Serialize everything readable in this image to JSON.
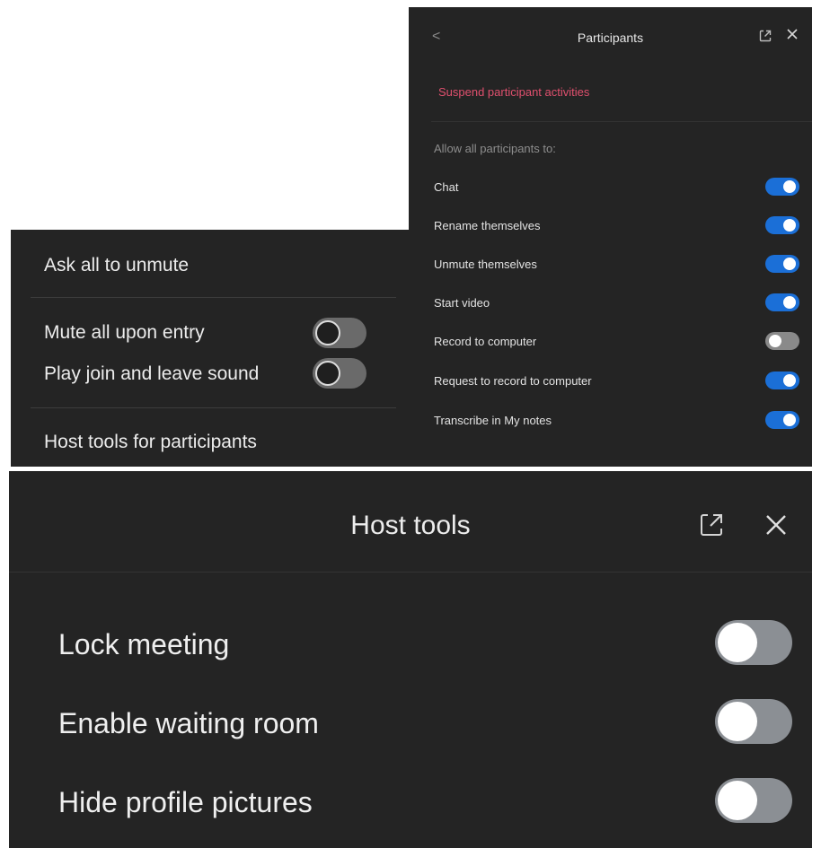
{
  "participants_panel": {
    "back_glyph": "<",
    "title": "Participants",
    "popout_icon": "popout-icon",
    "close_icon": "close-icon",
    "suspend_label": "Suspend participant activities",
    "allow_heading": "Allow all participants to:",
    "toggles": [
      {
        "label": "Chat",
        "on": true
      },
      {
        "label": "Rename themselves",
        "on": true
      },
      {
        "label": "Unmute themselves",
        "on": true
      },
      {
        "label": "Start video",
        "on": true
      },
      {
        "label": "Record to computer",
        "on": false
      },
      {
        "label": "Request to record to computer",
        "on": true
      },
      {
        "label": "Transcribe in My notes",
        "on": true
      }
    ],
    "colors": {
      "accent_on": "#1b6fd7",
      "danger_text": "#e0506e",
      "background": "#242424"
    }
  },
  "menu_panel": {
    "ask_unmute": "Ask all to unmute",
    "mute_on_entry": {
      "label": "Mute all upon entry",
      "on": false
    },
    "play_sound": {
      "label": "Play join and leave sound",
      "on": false
    },
    "host_tools_link": "Host tools for participants"
  },
  "host_tools_panel": {
    "title": "Host tools",
    "popout_icon": "popout-icon",
    "close_icon": "close-icon",
    "toggles": [
      {
        "label": "Lock meeting",
        "on": false
      },
      {
        "label": "Enable waiting room",
        "on": false
      },
      {
        "label": "Hide profile pictures",
        "on": false
      }
    ]
  }
}
